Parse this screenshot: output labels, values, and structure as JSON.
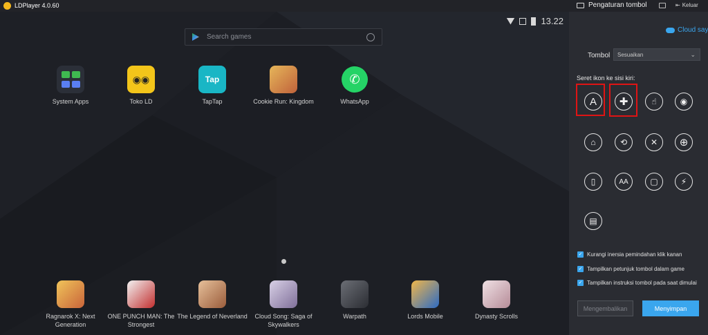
{
  "titlebar": {
    "app_title": "LDPlayer 4.0.60",
    "key_settings_title": "Pengaturan tombol",
    "exit_label": "Keluar"
  },
  "statusbar": {
    "time": "13.22"
  },
  "search": {
    "placeholder": "Search games"
  },
  "top_apps": [
    {
      "label": "System Apps",
      "color": "#2b2f38"
    },
    {
      "label": "Toko LD",
      "color": "#f3c51a"
    },
    {
      "label": "TapTap",
      "color": "#19b6c5",
      "icon_text": "Tap"
    },
    {
      "label": "Cookie Run: Kingdom",
      "color": "#c9a47a"
    },
    {
      "label": "WhatsApp",
      "color": "#25d366"
    }
  ],
  "bottom_apps": [
    {
      "label": "Ragnarok X: Next Generation",
      "color": "#e9b44c"
    },
    {
      "label": "ONE PUNCH MAN: The Strongest",
      "color": "#d8d8d8"
    },
    {
      "label": "The Legend of Neverland",
      "color": "#d9a77d"
    },
    {
      "label": "Cloud Song: Saga of Skywalkers",
      "color": "#b9b1c9"
    },
    {
      "label": "Warpath",
      "color": "#4a4d55"
    },
    {
      "label": "Lords Mobile",
      "color": "#3d7fd1"
    },
    {
      "label": "Dynasty Scrolls",
      "color": "#d7c0c6"
    }
  ],
  "panel": {
    "cloud_label": "Cloud saya",
    "tombol_label": "Tombol",
    "select_value": "Sesuaikan",
    "drag_title": "Seret ikon ke sisi kiri:",
    "tools": [
      {
        "name": "key-a-tool",
        "glyph": "A"
      },
      {
        "name": "dpad-tool",
        "glyph": "✚"
      },
      {
        "name": "tap-tool",
        "glyph": "☝"
      },
      {
        "name": "view-tool",
        "glyph": "◉"
      },
      {
        "name": "joystick-tool",
        "glyph": "⌂"
      },
      {
        "name": "rotate-tool",
        "glyph": "⟲"
      },
      {
        "name": "skill-tool",
        "glyph": "✕"
      },
      {
        "name": "aim-tool",
        "glyph": "⊕"
      },
      {
        "name": "mouse-tool",
        "glyph": "▯"
      },
      {
        "name": "multi-key-tool",
        "glyph": "AA"
      },
      {
        "name": "shake-tool",
        "glyph": "▢"
      },
      {
        "name": "flash-tool",
        "glyph": "⚡"
      },
      {
        "name": "script-tool",
        "glyph": "▤"
      }
    ],
    "checks": [
      "Kurangi inersia pemindahan klik kanan",
      "Tampilkan petunjuk tombol dalam game",
      "Tampilkan instruksi tombol pada saat dimulai"
    ],
    "reset_label": "Mengembalikan",
    "save_label": "Menyimpan"
  }
}
